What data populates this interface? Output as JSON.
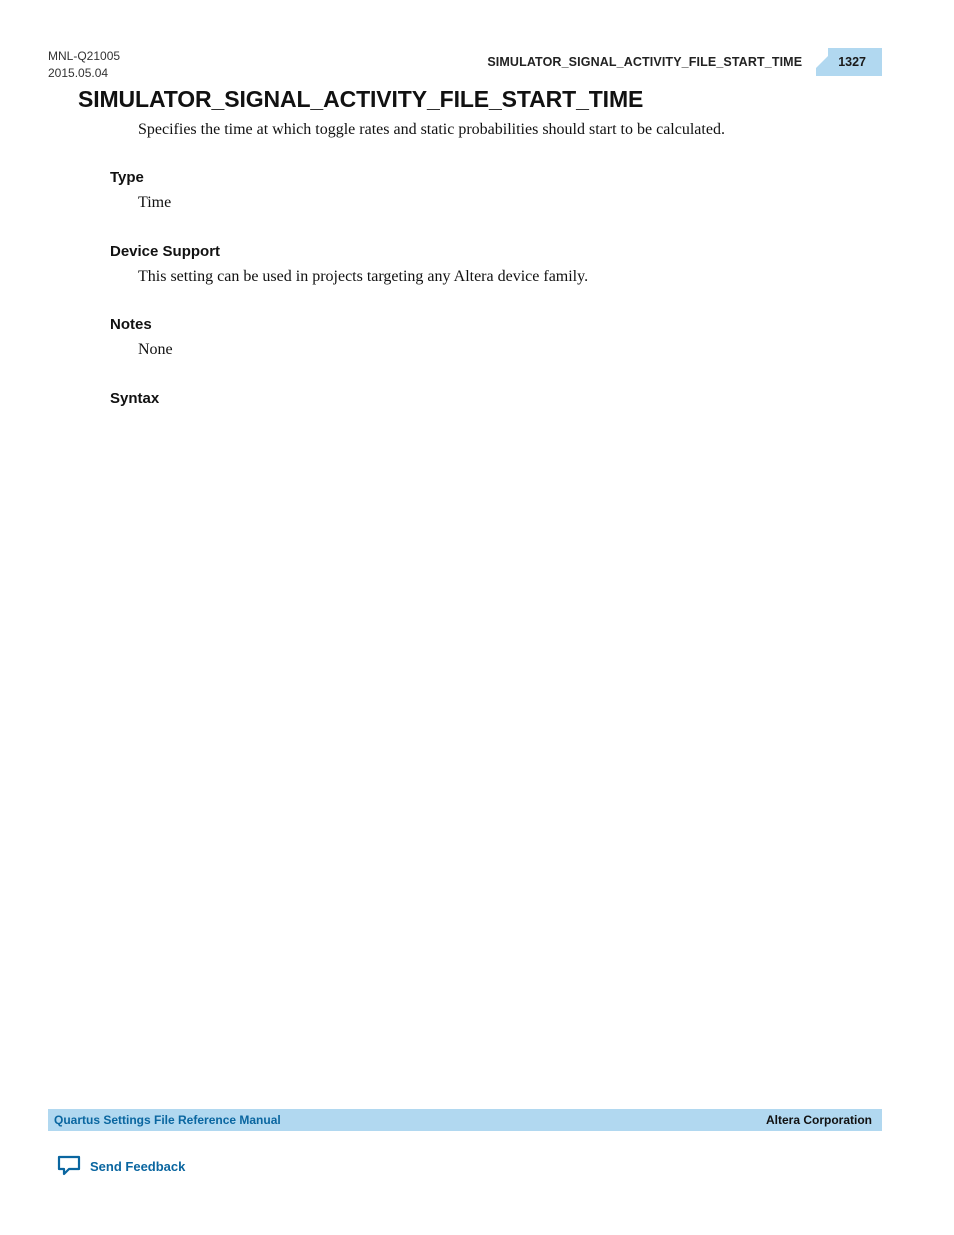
{
  "header": {
    "doc_id": "MNL-Q21005",
    "doc_date": "2015.05.04",
    "running_title": "SIMULATOR_SIGNAL_ACTIVITY_FILE_START_TIME",
    "page_number": "1327"
  },
  "content": {
    "title": "SIMULATOR_SIGNAL_ACTIVITY_FILE_START_TIME",
    "intro": "Specifies the time at which toggle rates and static probabilities should start to be calculated.",
    "sections": {
      "type": {
        "heading": "Type",
        "body": "Time"
      },
      "device_support": {
        "heading": "Device Support",
        "body": "This setting can be used in projects targeting any Altera device family."
      },
      "notes": {
        "heading": "Notes",
        "body": "None"
      },
      "syntax": {
        "heading": "Syntax",
        "body": ""
      }
    }
  },
  "footer": {
    "manual_title": "Quartus Settings File Reference Manual",
    "company": "Altera Corporation",
    "feedback_label": "Send Feedback"
  },
  "colors": {
    "accent_bg": "#b1d8f0",
    "link": "#0a66a0"
  }
}
